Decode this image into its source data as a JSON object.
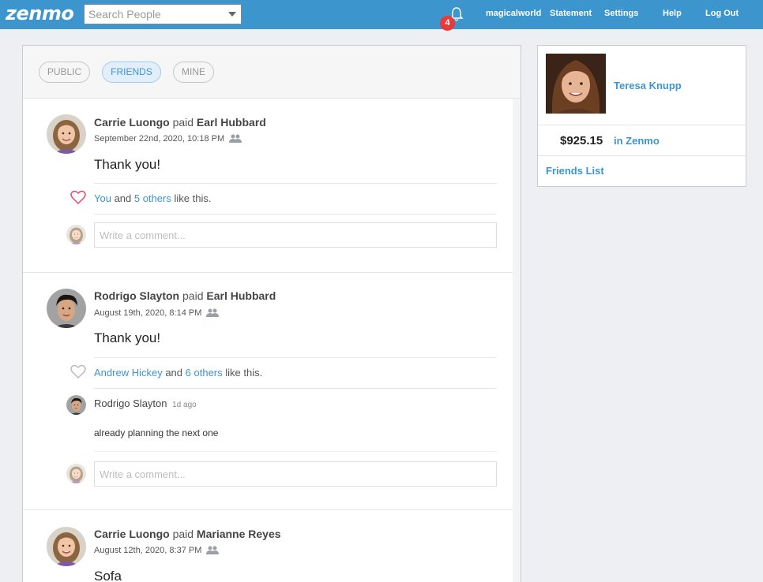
{
  "app": {
    "logo": "zenmo"
  },
  "header": {
    "search_placeholder": "Search People",
    "notifications_count": "4",
    "nav": {
      "username": "magicalworld",
      "statement": "Statement",
      "settings": "Settings",
      "help": "Help",
      "logout": "Log Out"
    }
  },
  "feed": {
    "tabs": [
      "PUBLIC",
      "FRIENDS",
      "MINE"
    ],
    "active_tab": "FRIENDS",
    "comment_placeholder": "Write a comment...",
    "stories": [
      {
        "payer": "Carrie Luongo",
        "verb": "paid",
        "payee": "Earl Hubbard",
        "date": "September 22nd, 2020, 10:18 PM",
        "note": "Thank you!",
        "liked_by_me": true,
        "likes_lead": "You",
        "likes_and": "and",
        "likes_others": "5 others",
        "likes_tail": "like this."
      },
      {
        "payer": "Rodrigo Slayton",
        "verb": "paid",
        "payee": "Earl Hubbard",
        "date": "August 19th, 2020, 8:14 PM",
        "note": "Thank you!",
        "liked_by_me": false,
        "likes_lead": "Andrew Hickey",
        "likes_and": "and",
        "likes_others": "6 others",
        "likes_tail": "like this.",
        "comments": [
          {
            "author": "Rodrigo Slayton",
            "ago": "1d ago",
            "text": "already planning the next one"
          }
        ]
      },
      {
        "payer": "Carrie Luongo",
        "verb": "paid",
        "payee": "Marianne Reyes",
        "date": "August 12th, 2020, 8:37 PM",
        "note": "Sofa"
      }
    ]
  },
  "profile": {
    "name": "Teresa Knupp",
    "balance": "$925.15",
    "balance_suffix": "in Zenmo",
    "friends_link": "Friends List"
  },
  "colors": {
    "brand": "#3d95ce",
    "badge": "#e73b3b",
    "heart_active": "#e84a6a",
    "heart_inactive": "#bbbbbb"
  }
}
